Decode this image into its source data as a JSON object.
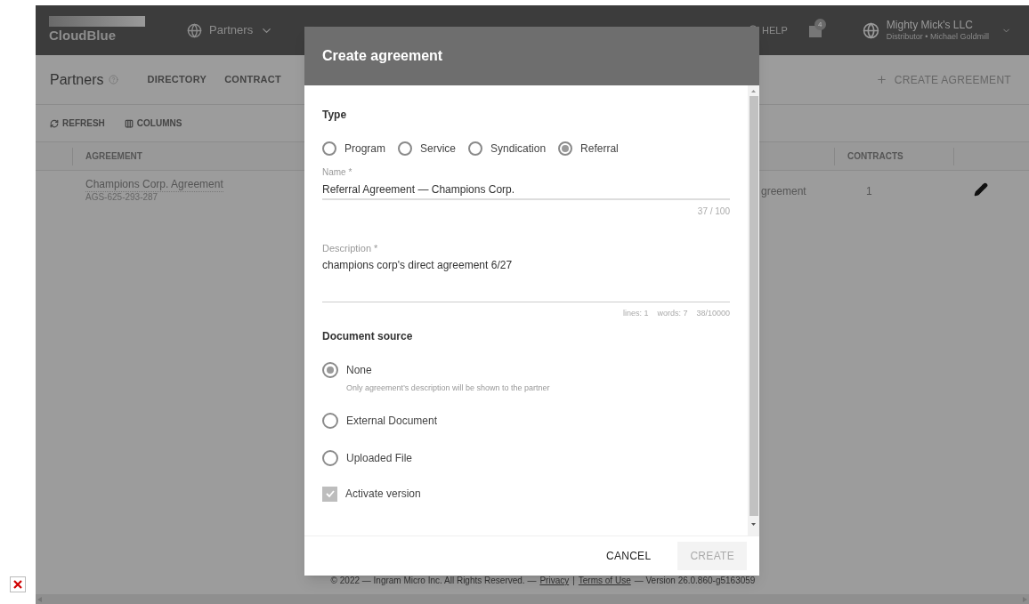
{
  "header": {
    "logo": "CloudBlue",
    "module": "Partners",
    "help": "HELP",
    "notifications": "4",
    "account": {
      "name": "Mighty Mick's LLC",
      "subtitle": "Distributor • Michael Goldmill"
    }
  },
  "page": {
    "title": "Partners",
    "tabs": [
      {
        "label": "DIRECTORY",
        "selected": false
      },
      {
        "label": "CONTRACT",
        "selected": false
      }
    ],
    "action": "CREATE AGREEMENT"
  },
  "toolbar": [
    {
      "kind": "refresh",
      "label": "REFRESH"
    },
    {
      "kind": "columns",
      "label": "COLUMNS"
    }
  ],
  "table": {
    "columns": [
      "AGREEMENT",
      "CONTRACTS"
    ],
    "rows": [
      {
        "name": "Champions Corp. Agreement",
        "id": "AGS-625-293-287",
        "column_3": "greement",
        "contracts": "1"
      }
    ]
  },
  "footer": {
    "copyright": "© 2022 — Ingram Micro Inc. All Rights Reserved. —",
    "links": [
      "Privacy",
      "Terms of Use"
    ],
    "separator": "|",
    "version": "— Version 26.0.860-g5163059"
  },
  "dialog": {
    "title": "Create agreement",
    "type": {
      "label": "Type",
      "options": [
        {
          "label": "Program",
          "selected": false
        },
        {
          "label": "Service",
          "selected": false
        },
        {
          "label": "Syndication",
          "selected": false
        },
        {
          "label": "Referral",
          "selected": true
        }
      ]
    },
    "name": {
      "label": "Name *",
      "value": "Referral Agreement — Champions Corp.",
      "counter": "37 / 100"
    },
    "description": {
      "label": "Description *",
      "value": "champions corp's direct agreement 6/27",
      "stats": [
        "lines: 1",
        "words: 7",
        "38/10000"
      ]
    },
    "document_source": {
      "label": "Document source",
      "options": [
        {
          "label": "None",
          "selected": true,
          "hint": "Only agreement’s description will be shown to the partner"
        },
        {
          "label": "External Document",
          "selected": false
        },
        {
          "label": "Uploaded File",
          "selected": false
        }
      ]
    },
    "activate": {
      "label": "Activate version",
      "checked": true
    },
    "buttons": [
      {
        "label": "CANCEL",
        "disabled": false
      },
      {
        "label": "CREATE",
        "disabled": true
      }
    ]
  }
}
